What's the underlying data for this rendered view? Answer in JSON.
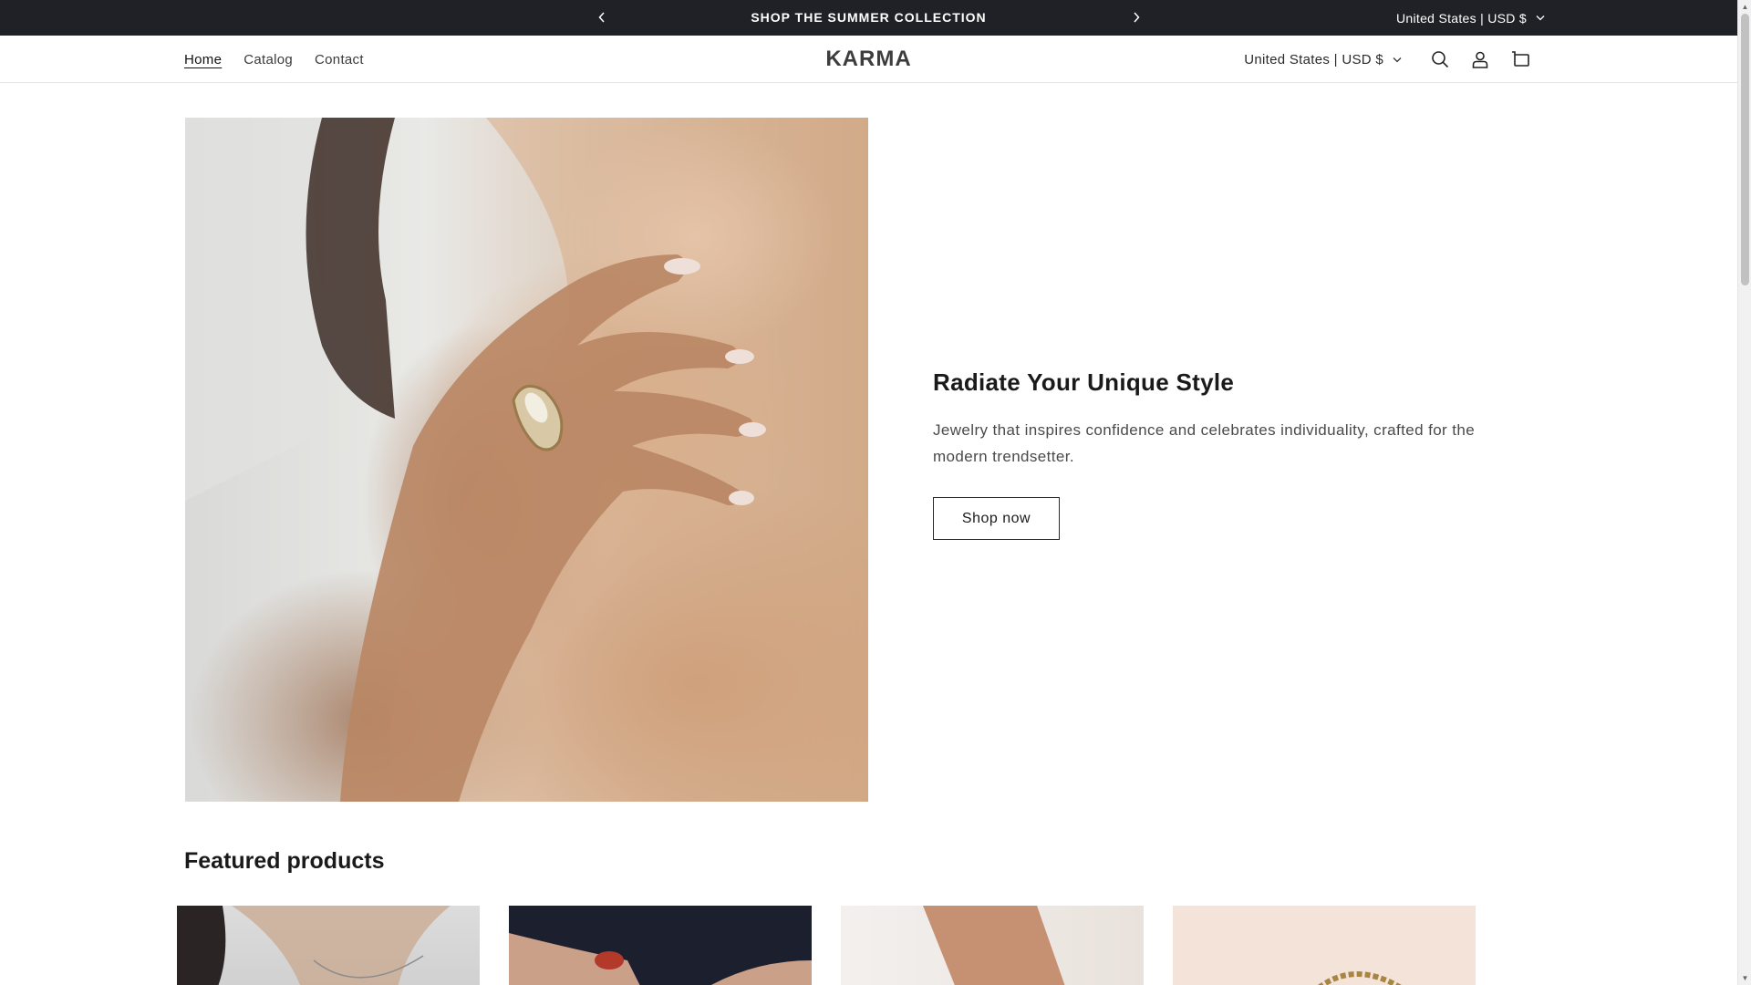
{
  "announcement": {
    "message": "SHOP THE SUMMER COLLECTION",
    "locale_label": "United States | USD $"
  },
  "header": {
    "logo": "KARMA",
    "nav": [
      {
        "label": "Home",
        "active": true
      },
      {
        "label": "Catalog",
        "active": false
      },
      {
        "label": "Contact",
        "active": false
      }
    ],
    "locale_label": "United States | USD $"
  },
  "hero": {
    "title": "Radiate Your Unique Style",
    "text": "Jewelry that inspires confidence and celebrates individuality, crafted for the modern trendsetter.",
    "button_label": "Shop now"
  },
  "featured": {
    "title": "Featured products"
  },
  "colors": {
    "announcement_bg": "#202127",
    "text": "#121212"
  }
}
